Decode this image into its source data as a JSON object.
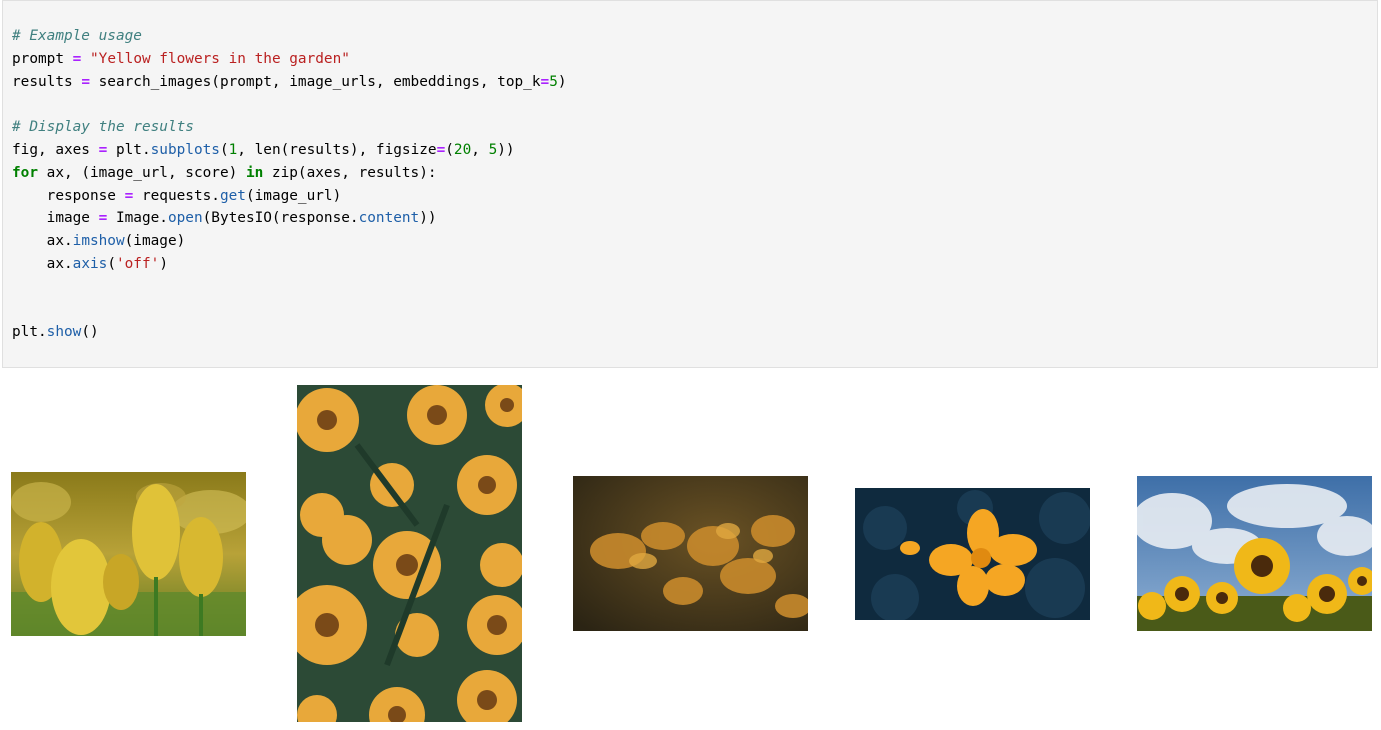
{
  "code_cell": {
    "lines": [
      [
        {
          "t": "# Example usage",
          "c": "cm"
        }
      ],
      [
        {
          "t": "prompt "
        },
        {
          "t": "=",
          "c": "op"
        },
        {
          "t": " "
        },
        {
          "t": "\"Yellow flowers in the garden\"",
          "c": "st"
        }
      ],
      [
        {
          "t": "results "
        },
        {
          "t": "=",
          "c": "op"
        },
        {
          "t": " search_images(prompt, image_urls, embeddings, top_k"
        },
        {
          "t": "=",
          "c": "op"
        },
        {
          "t": "5",
          "c": "nu"
        },
        {
          "t": ")"
        }
      ],
      [],
      [
        {
          "t": "# Display the results",
          "c": "cm"
        }
      ],
      [
        {
          "t": "fig, axes "
        },
        {
          "t": "=",
          "c": "op"
        },
        {
          "t": " plt."
        },
        {
          "t": "subplots",
          "c": "at"
        },
        {
          "t": "("
        },
        {
          "t": "1",
          "c": "nu"
        },
        {
          "t": ", len(results), figsize"
        },
        {
          "t": "=",
          "c": "op"
        },
        {
          "t": "("
        },
        {
          "t": "20",
          "c": "nu"
        },
        {
          "t": ", "
        },
        {
          "t": "5",
          "c": "nu"
        },
        {
          "t": "))"
        }
      ],
      [
        {
          "t": "for",
          "c": "kw"
        },
        {
          "t": " ax, (image_url, score) "
        },
        {
          "t": "in",
          "c": "kw"
        },
        {
          "t": " zip(axes, results):"
        }
      ],
      [
        {
          "t": "    response "
        },
        {
          "t": "=",
          "c": "op"
        },
        {
          "t": " requests."
        },
        {
          "t": "get",
          "c": "at"
        },
        {
          "t": "(image_url)"
        }
      ],
      [
        {
          "t": "    image "
        },
        {
          "t": "=",
          "c": "op"
        },
        {
          "t": " Image."
        },
        {
          "t": "open",
          "c": "at"
        },
        {
          "t": "(BytesIO(response."
        },
        {
          "t": "content",
          "c": "at"
        },
        {
          "t": "))"
        }
      ],
      [
        {
          "t": "    ax."
        },
        {
          "t": "imshow",
          "c": "at"
        },
        {
          "t": "(image)"
        }
      ],
      [
        {
          "t": "    ax."
        },
        {
          "t": "axis",
          "c": "at"
        },
        {
          "t": "("
        },
        {
          "t": "'off'",
          "c": "st"
        },
        {
          "t": ")"
        }
      ],
      [],
      [],
      [
        {
          "t": "plt."
        },
        {
          "t": "show",
          "c": "at"
        },
        {
          "t": "()"
        }
      ]
    ]
  },
  "output_images": [
    {
      "name": "yellow-tulips-image"
    },
    {
      "name": "orange-daisies-image"
    },
    {
      "name": "dried-orange-flowers-image"
    },
    {
      "name": "orange-cosmos-flower-image"
    },
    {
      "name": "sunflowers-sky-image"
    }
  ]
}
